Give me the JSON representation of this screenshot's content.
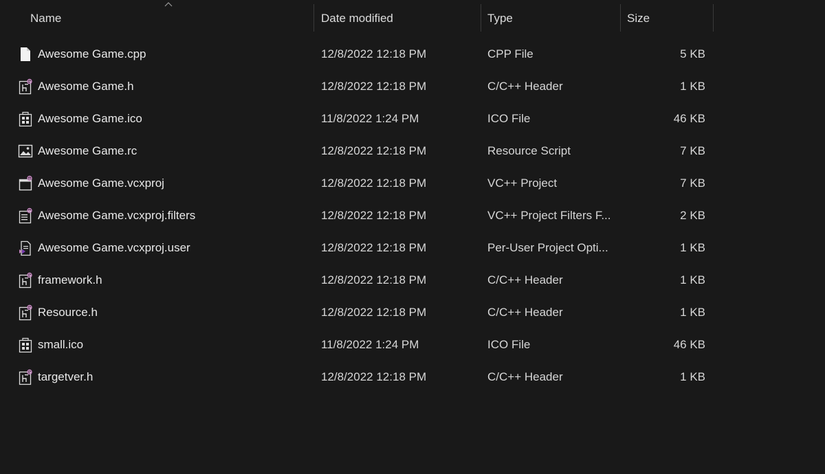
{
  "columns": {
    "name": "Name",
    "date": "Date modified",
    "type": "Type",
    "size": "Size"
  },
  "files": [
    {
      "name": "Awesome Game.cpp",
      "date": "12/8/2022 12:18 PM",
      "type": "CPP File",
      "size": "5 KB",
      "icon": "cpp-file-icon"
    },
    {
      "name": "Awesome Game.h",
      "date": "12/8/2022 12:18 PM",
      "type": "C/C++ Header",
      "size": "1 KB",
      "icon": "header-file-icon"
    },
    {
      "name": "Awesome Game.ico",
      "date": "11/8/2022 1:24 PM",
      "type": "ICO File",
      "size": "46 KB",
      "icon": "ico-file-icon"
    },
    {
      "name": "Awesome Game.rc",
      "date": "12/8/2022 12:18 PM",
      "type": "Resource Script",
      "size": "7 KB",
      "icon": "resource-script-icon"
    },
    {
      "name": "Awesome Game.vcxproj",
      "date": "12/8/2022 12:18 PM",
      "type": "VC++ Project",
      "size": "7 KB",
      "icon": "vcxproj-file-icon"
    },
    {
      "name": "Awesome Game.vcxproj.filters",
      "date": "12/8/2022 12:18 PM",
      "type": "VC++ Project Filters F...",
      "size": "2 KB",
      "icon": "filters-file-icon"
    },
    {
      "name": "Awesome Game.vcxproj.user",
      "date": "12/8/2022 12:18 PM",
      "type": "Per-User Project Opti...",
      "size": "1 KB",
      "icon": "user-options-file-icon"
    },
    {
      "name": "framework.h",
      "date": "12/8/2022 12:18 PM",
      "type": "C/C++ Header",
      "size": "1 KB",
      "icon": "header-file-icon"
    },
    {
      "name": "Resource.h",
      "date": "12/8/2022 12:18 PM",
      "type": "C/C++ Header",
      "size": "1 KB",
      "icon": "header-file-icon"
    },
    {
      "name": "small.ico",
      "date": "11/8/2022 1:24 PM",
      "type": "ICO File",
      "size": "46 KB",
      "icon": "ico-file-icon"
    },
    {
      "name": "targetver.h",
      "date": "12/8/2022 12:18 PM",
      "type": "C/C++ Header",
      "size": "1 KB",
      "icon": "header-file-icon"
    }
  ],
  "colors": {
    "background": "#191919",
    "text": "#e8e8e8",
    "accent": "#c586c0"
  }
}
